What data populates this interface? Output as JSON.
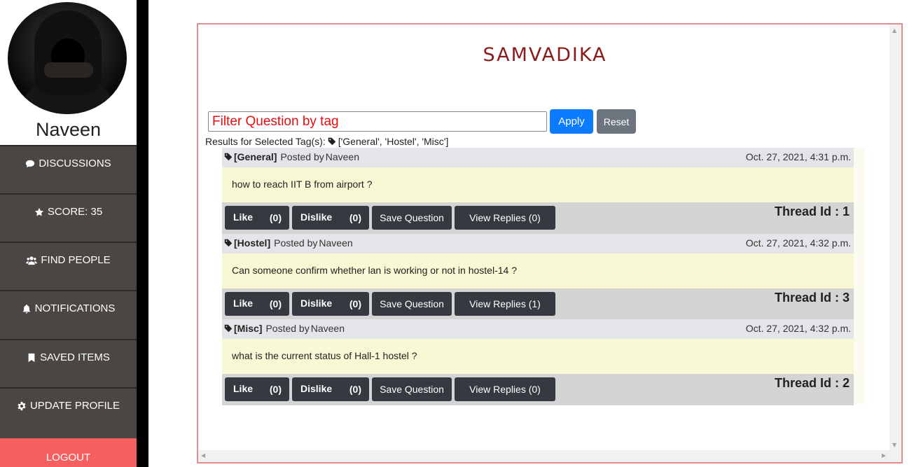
{
  "sidebar": {
    "username": "Naveen",
    "items": [
      {
        "label": "DISCUSSIONS",
        "icon": "comment-icon"
      },
      {
        "label": "SCORE: 35",
        "icon": "star-icon"
      },
      {
        "label": "FIND PEOPLE",
        "icon": "users-icon"
      },
      {
        "label": "NOTIFICATIONS",
        "icon": "bell-icon"
      },
      {
        "label": "SAVED ITEMS",
        "icon": "bookmark-icon"
      },
      {
        "label": "UPDATE PROFILE",
        "icon": "gear-icon"
      }
    ],
    "logout": "LOGOUT"
  },
  "main": {
    "title": "SAMVADIKA",
    "filter": {
      "placeholder": "Filter Question by tag",
      "value": "",
      "apply_label": "Apply",
      "reset_label": "Reset"
    },
    "results_prefix": "Results for Selected Tag(s):",
    "results_tags": "['General', 'Hostel', 'Misc']",
    "posted_by_prefix": "Posted by",
    "buttons": {
      "like": "Like",
      "dislike": "Dislike",
      "save": "Save Question"
    },
    "threads": [
      {
        "tag": "[General]",
        "author": "Naveen",
        "date": "Oct. 27, 2021, 4:31 p.m.",
        "question": "how to reach IIT B from airport ?",
        "likes": "(0)",
        "dislikes": "(0)",
        "view_replies": "View Replies (0)",
        "thread_id": "Thread Id : 1"
      },
      {
        "tag": "[Hostel]",
        "author": "Naveen",
        "date": "Oct. 27, 2021, 4:32 p.m.",
        "question": "Can someone confirm whether lan is working or not in hostel-14 ?",
        "likes": "(0)",
        "dislikes": "(0)",
        "view_replies": "View Replies (1)",
        "thread_id": "Thread Id : 3"
      },
      {
        "tag": "[Misc]",
        "author": "Naveen",
        "date": "Oct. 27, 2021, 4:32 p.m.",
        "question": "what is the current status of Hall-1 hostel ?",
        "likes": "(0)",
        "dislikes": "(0)",
        "view_replies": "View Replies (0)",
        "thread_id": "Thread Id : 2"
      }
    ]
  },
  "colors": {
    "title": "#8b1a1a",
    "apply": "#0b7bff",
    "reset": "#6c757d",
    "logout": "#f55f5f",
    "sidebar": "#4a4644",
    "action_button": "#343a40"
  }
}
